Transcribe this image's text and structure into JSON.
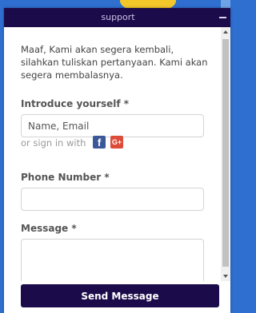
{
  "widget": {
    "title": "support"
  },
  "intro_text": "Maaf, Kami akan segera kembali, silahkan tuliskan pertanyaan. Kami akan segera membalasnya.",
  "fields": {
    "introduce": {
      "label": "Introduce yourself *",
      "placeholder": "Name, Email",
      "value": ""
    },
    "phone": {
      "label": "Phone Number *",
      "placeholder": "",
      "value": ""
    },
    "message": {
      "label": "Message *",
      "placeholder": "",
      "value": ""
    }
  },
  "signin": {
    "text": "or sign in with",
    "facebook_glyph": "f",
    "google_glyph": "G+"
  },
  "send_button_label": "Send Message",
  "icons": {
    "minimize": "minimize-icon",
    "facebook": "facebook-icon",
    "google": "google-plus-icon"
  },
  "colors": {
    "header": "#1c0b4a",
    "button": "#1c0b4a",
    "facebook": "#3b5998",
    "google": "#dd4b39"
  }
}
